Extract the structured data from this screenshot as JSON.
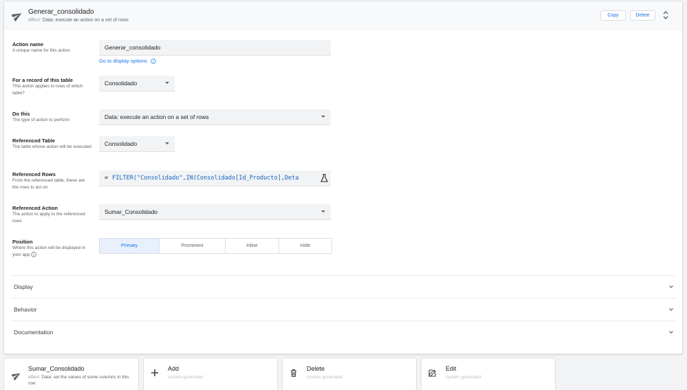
{
  "action": {
    "header_title": "Generar_consolidado",
    "effect_label": "effect:",
    "effect_value": "Data: execute an action on a set of rows",
    "copy_label": "Copy",
    "delete_label": "Delete"
  },
  "form": {
    "action_name": {
      "title": "Action name",
      "description": "A unique name for this action",
      "value": "Generar_consolidado",
      "link": "Go to display options"
    },
    "table": {
      "title": "For a record of this table",
      "description": "This action applies to rows of which table?",
      "value": "Consolidado"
    },
    "do_this": {
      "title": "Do this",
      "description": "The type of action to perform",
      "value": "Data: execute an action on a set of rows"
    },
    "referenced_table": {
      "title": "Referenced Table",
      "description": "The table whose action will be executed",
      "value": "Consolidado"
    },
    "referenced_rows": {
      "title": "Referenced Rows",
      "description": "From the referenced table, these are the rows to act on",
      "eq": "=",
      "expression": "FILTER(\"Consolidado\",IN(Consolidado[Id_Producto],Deta"
    },
    "referenced_action": {
      "title": "Referenced Action",
      "description": "The action to apply to the referenced rows",
      "value": "Sumar_Consolidado"
    },
    "position": {
      "title": "Position",
      "description": "Where this action will be displayed in your app",
      "options": [
        "Primary",
        "Prominent",
        "Inline",
        "Hide"
      ],
      "selected": "Primary"
    }
  },
  "sections": [
    "Display",
    "Behavior",
    "Documentation"
  ],
  "bottom_cards": [
    {
      "title": "Sumar_Consolidado",
      "effect_label": "effect:",
      "sub": "Data: set the values of some columns in this row",
      "icon": "send-icon"
    },
    {
      "title": "Add",
      "sub": "system generated",
      "icon": "plus-icon"
    },
    {
      "title": "Delete",
      "sub": "system generated",
      "icon": "trash-icon"
    },
    {
      "title": "Edit",
      "sub": "system generated",
      "icon": "edit-icon"
    }
  ],
  "colors": {
    "accent": "#1a73e8",
    "field_bg": "#f1f3f4",
    "active_segment_bg": "#e8f0fe",
    "expression_text": "#1565c0"
  }
}
